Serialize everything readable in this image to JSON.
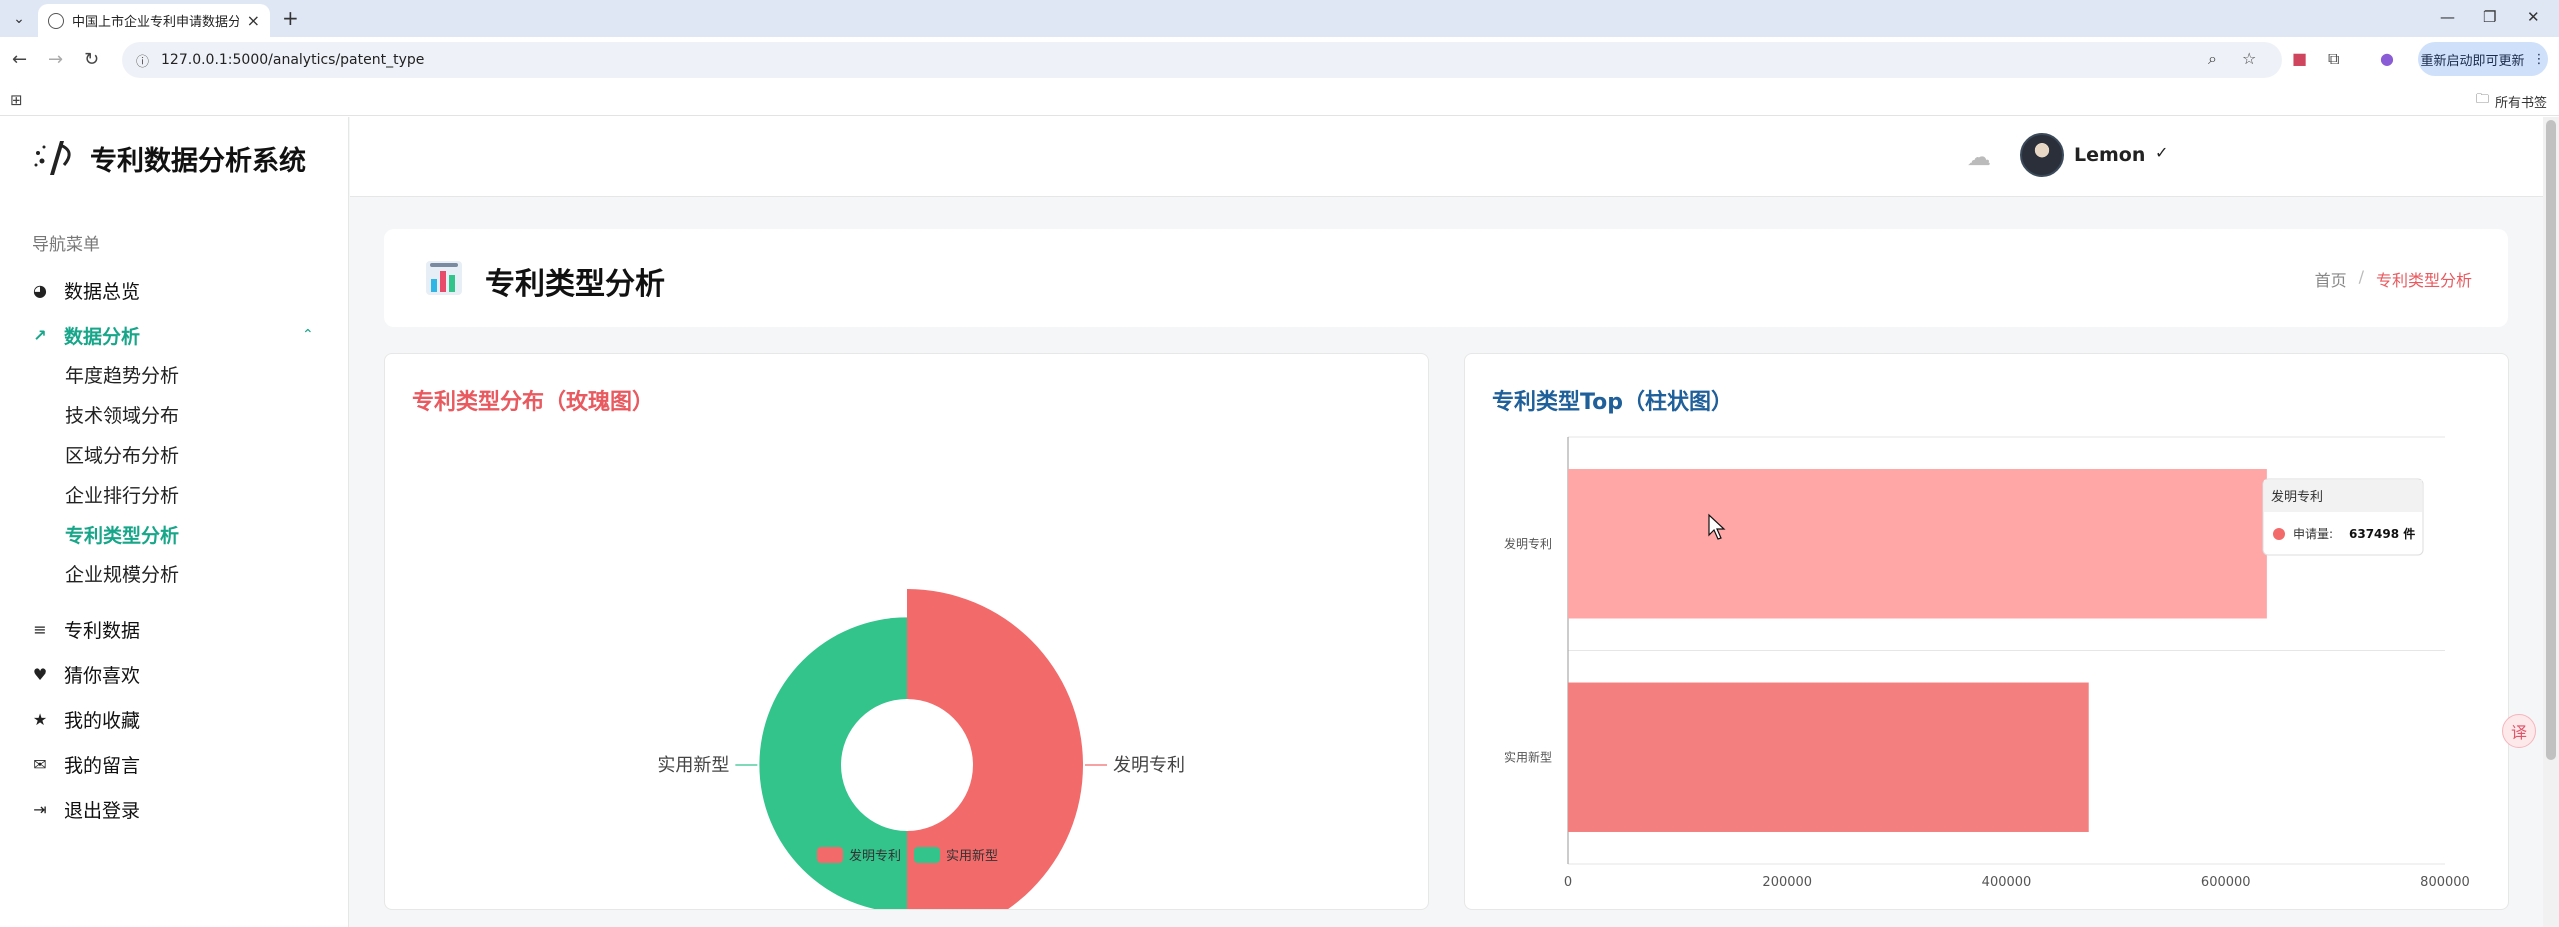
{
  "browser": {
    "tab_title": "中国上市企业专利申请数据分析",
    "url": "127.0.0.1:5000/analytics/patent_type",
    "update_label": "重新启动即可更新",
    "all_bookmarks": "所有书签"
  },
  "app": {
    "name": "专利数据分析系统",
    "user": "Lemon"
  },
  "sidebar": {
    "title": "导航菜单",
    "items": [
      {
        "label": "数据总览",
        "icon": "pie-chart-icon"
      },
      {
        "label": "数据分析",
        "icon": "trend-icon"
      },
      {
        "label": "专利数据",
        "icon": "database-icon"
      },
      {
        "label": "猜你喜欢",
        "icon": "heart-icon"
      },
      {
        "label": "我的收藏",
        "icon": "star-icon"
      },
      {
        "label": "我的留言",
        "icon": "chat-icon"
      },
      {
        "label": "退出登录",
        "icon": "logout-icon"
      }
    ],
    "sub_items": [
      "年度趋势分析",
      "技术领域分布",
      "区域分布分析",
      "企业排行分析",
      "专利类型分析",
      "企业规模分析"
    ]
  },
  "page": {
    "title": "专利类型分析",
    "breadcrumb": {
      "home": "首页",
      "sep": "/",
      "current": "专利类型分析"
    }
  },
  "colors": {
    "invention": "#f26a6a",
    "utility": "#33c48c",
    "bar_highlight": "#ffa6a6",
    "bar": "#f47f7f",
    "accent": "#17a689",
    "rose_title": "#e85a5f",
    "bar_title": "#1f5f9a"
  },
  "rose_card": {
    "title": "专利类型分布（玫瑰图）"
  },
  "bar_card": {
    "title": "专利类型Top（柱状图）"
  },
  "chart_data": [
    {
      "type": "pie",
      "title": "专利类型分布（玫瑰图）",
      "labels": [
        "发明专利",
        "实用新型"
      ],
      "values": [
        637498,
        475000
      ],
      "legend": "bottom-center"
    },
    {
      "type": "bar",
      "orientation": "horizontal",
      "title": "专利类型Top（柱状图）",
      "categories": [
        "发明专利",
        "实用新型"
      ],
      "values": [
        637498,
        475000
      ],
      "xlim": [
        0,
        800000
      ],
      "x_ticks": [
        "0",
        "200000",
        "400000",
        "600000",
        "800000"
      ],
      "tooltip": {
        "title": "发明专利",
        "label": "申请量:",
        "value": "637498 件"
      }
    }
  ]
}
